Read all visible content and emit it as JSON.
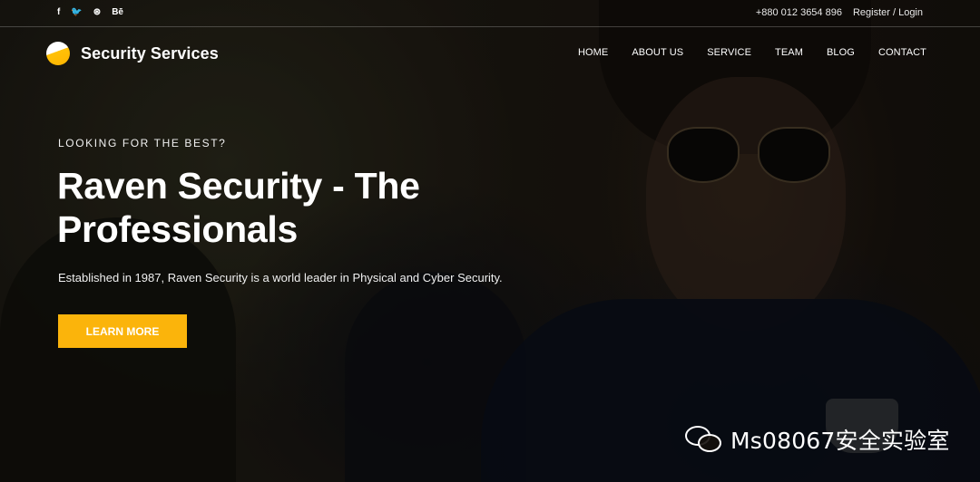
{
  "topbar": {
    "social": [
      {
        "icon": "facebook-icon",
        "glyph": "f"
      },
      {
        "icon": "twitter-icon",
        "glyph": "🐦"
      },
      {
        "icon": "dribbble-icon",
        "glyph": "⊛"
      },
      {
        "icon": "behance-icon",
        "glyph": "Bē"
      }
    ],
    "phone": "+880 012 3654 896",
    "auth": "Register / Login"
  },
  "header": {
    "brand": "Security Services",
    "nav": [
      "HOME",
      "ABOUT US",
      "SERVICE",
      "TEAM",
      "BLOG",
      "CONTACT"
    ]
  },
  "hero": {
    "eyebrow": "LOOKING FOR THE BEST?",
    "title_line1": "Raven Security - The",
    "title_line2": "Professionals",
    "subtitle": "Established in 1987, Raven Security is a world leader in Physical and Cyber Security.",
    "cta": "LEARN MORE"
  },
  "watermark": {
    "text": "Ms08067安全实验室"
  },
  "colors": {
    "accent": "#fbb40b",
    "text": "#ffffff"
  }
}
